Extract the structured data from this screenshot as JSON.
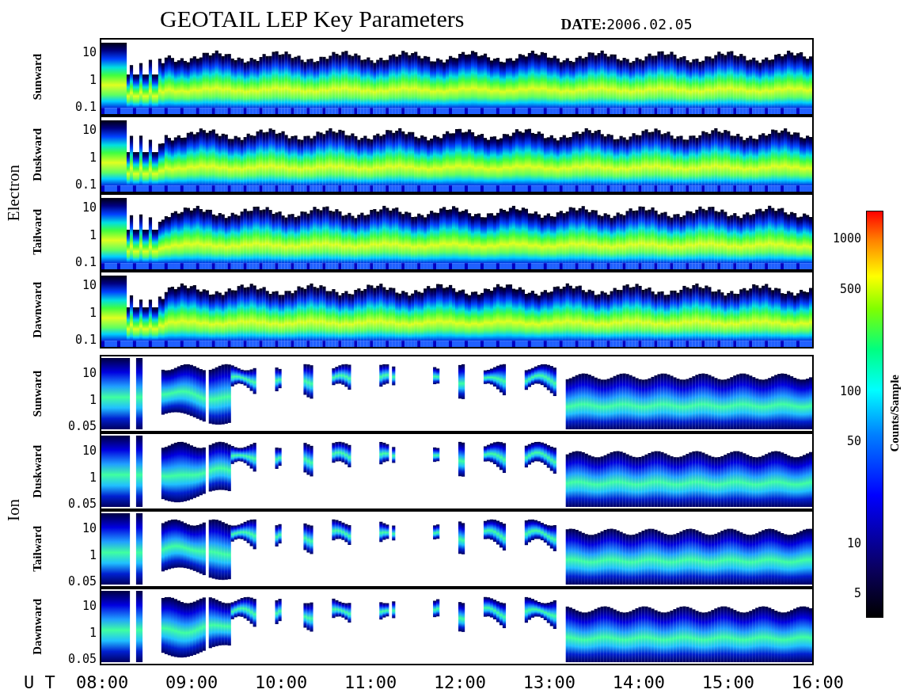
{
  "title": "GEOTAIL LEP Key Parameters",
  "date": {
    "label": "DATE:",
    "value": "2006.02.05"
  },
  "groups": [
    {
      "name": "Electron",
      "kind": "electron",
      "panels": [
        {
          "label": "Sunward",
          "yticks": [
            "10",
            "1",
            "0.1"
          ]
        },
        {
          "label": "Duskward",
          "yticks": [
            "10",
            "1",
            "0.1"
          ]
        },
        {
          "label": "Tailward",
          "yticks": [
            "10",
            "1",
            "0.1"
          ]
        },
        {
          "label": "Dawnward",
          "yticks": [
            "10",
            "1",
            "0.1"
          ]
        }
      ]
    },
    {
      "name": "Ion",
      "kind": "ion",
      "panels": [
        {
          "label": "Sunward",
          "yticks": [
            "10",
            "1",
            "0.05"
          ]
        },
        {
          "label": "Duskward",
          "yticks": [
            "10",
            "1",
            "0.05"
          ]
        },
        {
          "label": "Tailward",
          "yticks": [
            "10",
            "1",
            "0.05"
          ]
        },
        {
          "label": "Dawnward",
          "yticks": [
            "10",
            "1",
            "0.05"
          ]
        }
      ]
    }
  ],
  "x_axis": {
    "label": "U T",
    "ticks": [
      "08:00",
      "09:00",
      "10:00",
      "11:00",
      "12:00",
      "13:00",
      "14:00",
      "15:00",
      "16:00"
    ]
  },
  "colorbar": {
    "title": "Counts/Sample",
    "ticks": [
      "1000",
      "500",
      "100",
      "50",
      "10",
      "5"
    ]
  }
}
